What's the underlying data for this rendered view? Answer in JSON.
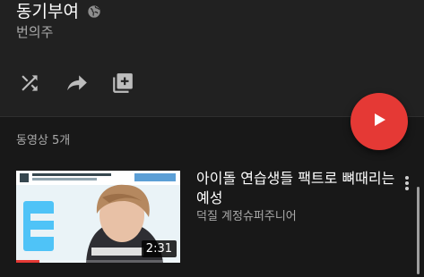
{
  "playlist": {
    "title": "동기부여",
    "privacy_icon": "globe-icon",
    "owner": "번의주"
  },
  "actions": [
    {
      "icon": "shuffle-icon"
    },
    {
      "icon": "share-icon"
    },
    {
      "icon": "add-to-playlist-icon"
    }
  ],
  "play_all_button": {
    "icon": "play-icon",
    "color": "#e53935"
  },
  "video_count": "동영상 5개",
  "videos": [
    {
      "title": "아이돌 연습생들 팩트로 뼈때리는 예성",
      "channel": "덕질 계정슈퍼주니어",
      "duration": "2:31",
      "watched_fraction": 0.14
    }
  ],
  "colors": {
    "background": "#212121",
    "list_background": "#181818",
    "accent": "#e53935",
    "secondary_text": "#aaaaaa"
  }
}
